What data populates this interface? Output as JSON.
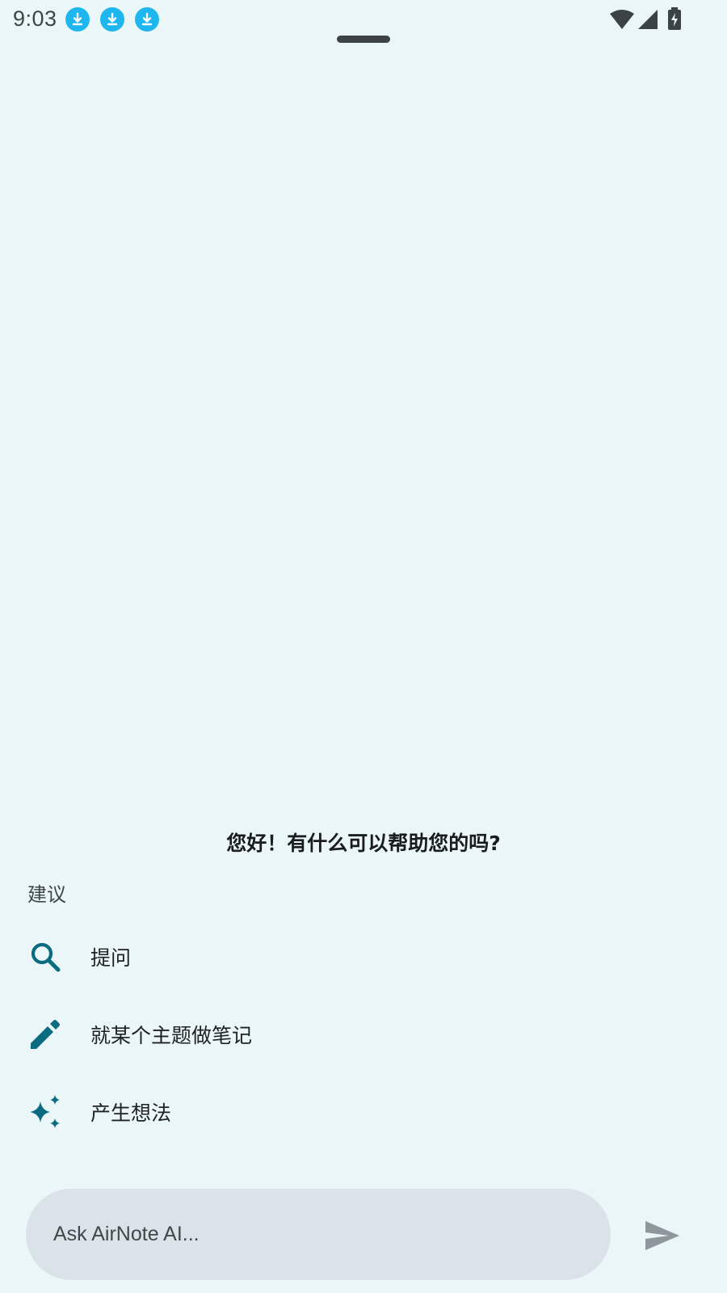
{
  "status_bar": {
    "time": "9:03",
    "notification_icons": [
      "download-icon",
      "download-icon",
      "download-icon"
    ],
    "right_icons": [
      "wifi-icon",
      "cellular-signal-icon",
      "battery-charging-icon"
    ]
  },
  "main": {
    "greeting": "您好！有什么可以帮助您的吗?",
    "suggestions_title": "建议",
    "suggestions": [
      {
        "icon": "search-icon",
        "label": "提问"
      },
      {
        "icon": "pencil-icon",
        "label": "就某个主题做笔记"
      },
      {
        "icon": "sparkle-icon",
        "label": "产生想法"
      }
    ]
  },
  "composer": {
    "placeholder": "Ask AirNote AI...",
    "send_icon": "send-icon"
  },
  "colors": {
    "background": "#EAF6F8",
    "accent": "#0B6B80",
    "notification": "#1EB6EE",
    "input_bg": "#DAE3E8"
  }
}
